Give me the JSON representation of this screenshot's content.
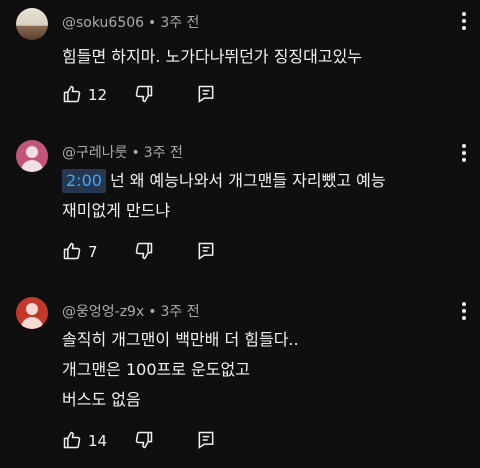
{
  "comments": [
    {
      "author": "@soku6506",
      "time": "3주 전",
      "lines": [
        "힘들면 하지마. 노가다나뛰던가 징징대고있누"
      ],
      "likes": "12"
    },
    {
      "author": "@구레나룻",
      "time": "3주 전",
      "timestamp": "2:00",
      "lines": [
        "넌 왜 예능나와서 개그맨들 자리뺐고 예능",
        "재미없게 만드냐"
      ],
      "likes": "7"
    },
    {
      "author": "@웅엉엉-z9x",
      "time": "3주 전",
      "lines": [
        "솔직히 개그맨이 백만배 더 힘들다..",
        "개그맨은 100프로 운도없고",
        "버스도 없음"
      ],
      "likes": "14"
    }
  ],
  "separator": "•",
  "icons": {
    "like": "thumbs-up-icon",
    "dislike": "thumbs-down-icon",
    "reply": "reply-icon",
    "menu": "more-vert-icon"
  }
}
